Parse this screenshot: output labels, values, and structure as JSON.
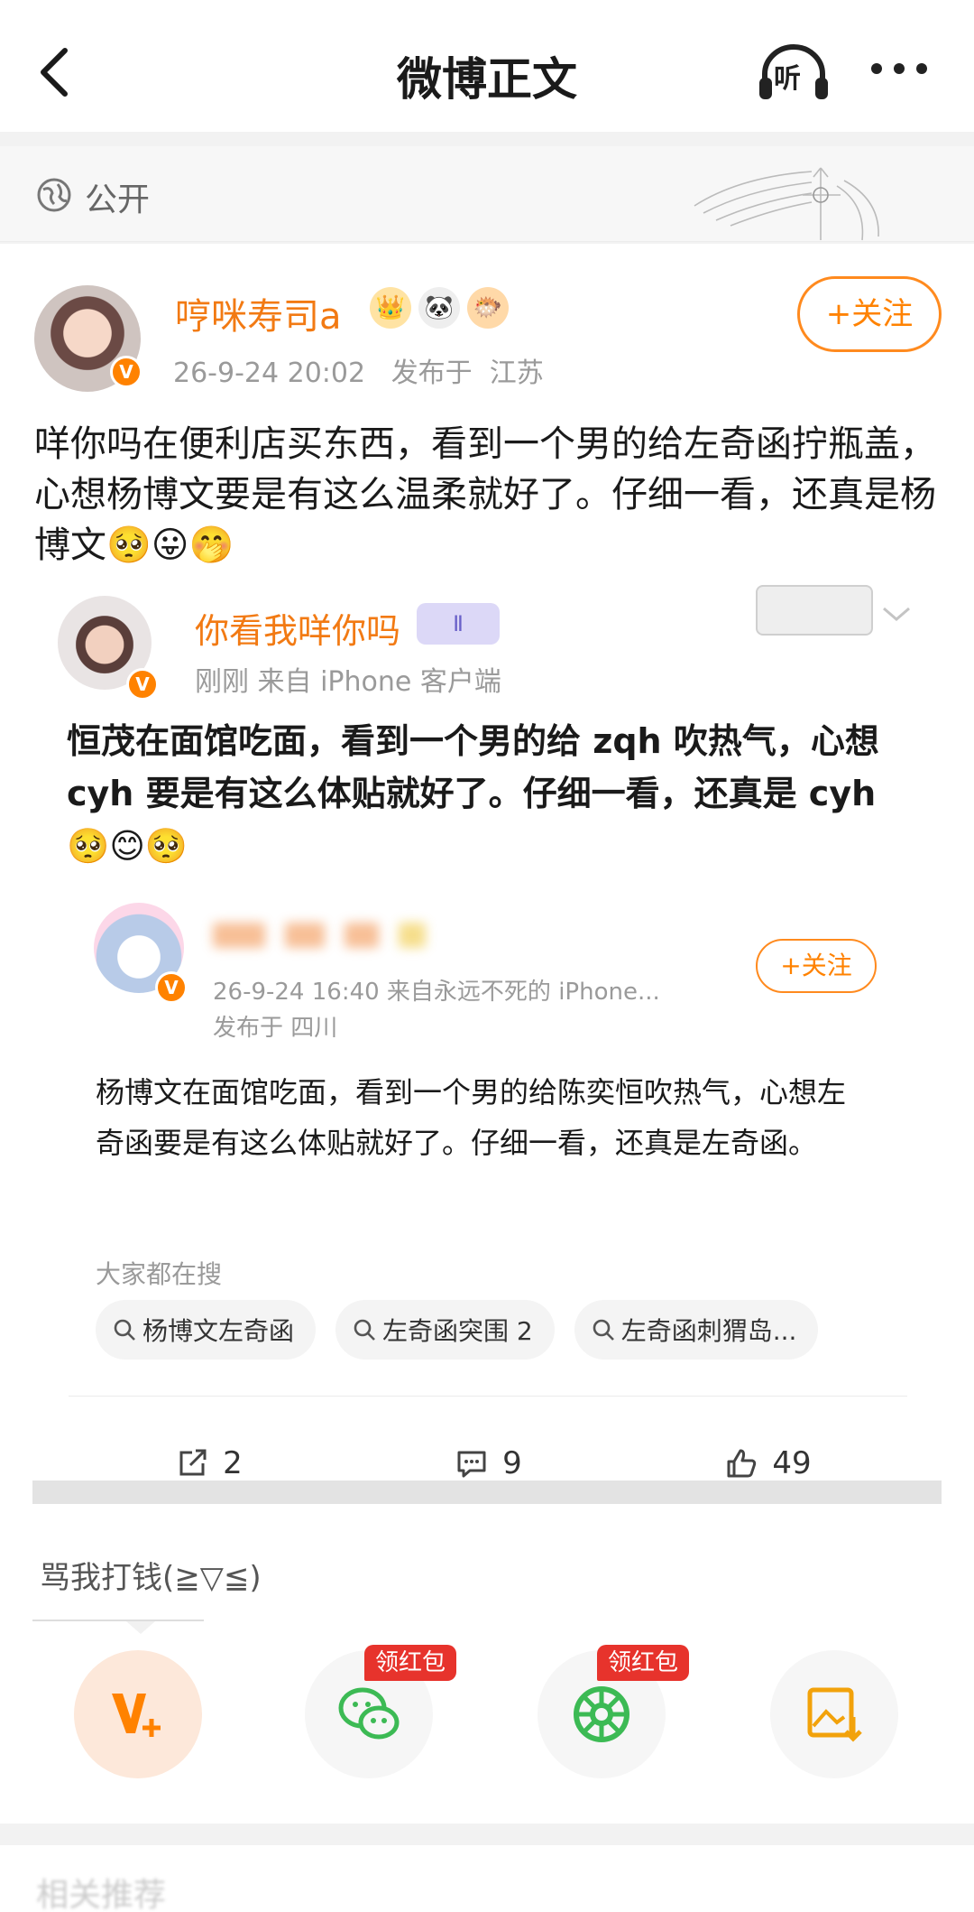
{
  "nav": {
    "title": "微博正文",
    "listen_label": "听"
  },
  "visibility": {
    "label": "公开"
  },
  "post": {
    "author": "哼咪寿司a",
    "time": "26-9-24 20:02",
    "location_prefix": "发布于",
    "location": "江苏",
    "follow_label": "+关注",
    "text": "咩你吗在便利店买东西，看到一个男的给左奇函拧瓶盖，心想杨博文要是有这么温柔就好了。仔细一看，还真是杨博文🥺😛🤭"
  },
  "quoted": {
    "author": "你看我咩你吗",
    "badge": "Ⅱ",
    "meta": "刚刚  来自 iPhone 客户端",
    "text": "恒茂在面馆吃面，看到一个男的给 zqh 吹热气，心想 cyh 要是有这么体贴就好了。仔细一看，还真是 cyh🥺😊🥺"
  },
  "nested": {
    "meta": "26-9-24 16:40  来自永远不死的 iPhone...",
    "location": "发布于 四川",
    "follow_label": "+关注",
    "text": "杨博文在面馆吃面，看到一个男的给陈奕恒吹热气，心想左奇函要是有这么体贴就好了。仔细一看，还真是左奇函。"
  },
  "hot_search": {
    "label": "大家都在搜",
    "tags": [
      "杨博文左奇函",
      "左奇函突围 2",
      "左奇函刺猬岛..."
    ]
  },
  "actions": {
    "repost": "2",
    "comment": "9",
    "like": "49"
  },
  "reward": {
    "title": "骂我打钱(≧▽≦)",
    "red_tag": "领红包",
    "items": [
      "vip-plus-icon",
      "wechat-icon",
      "moments-icon",
      "save-image-icon"
    ]
  },
  "footer": {
    "title": "相关推荐"
  },
  "colors": {
    "brand_orange": "#ff8200",
    "name_orange": "#f27a13",
    "red_tag": "#e7332c"
  }
}
